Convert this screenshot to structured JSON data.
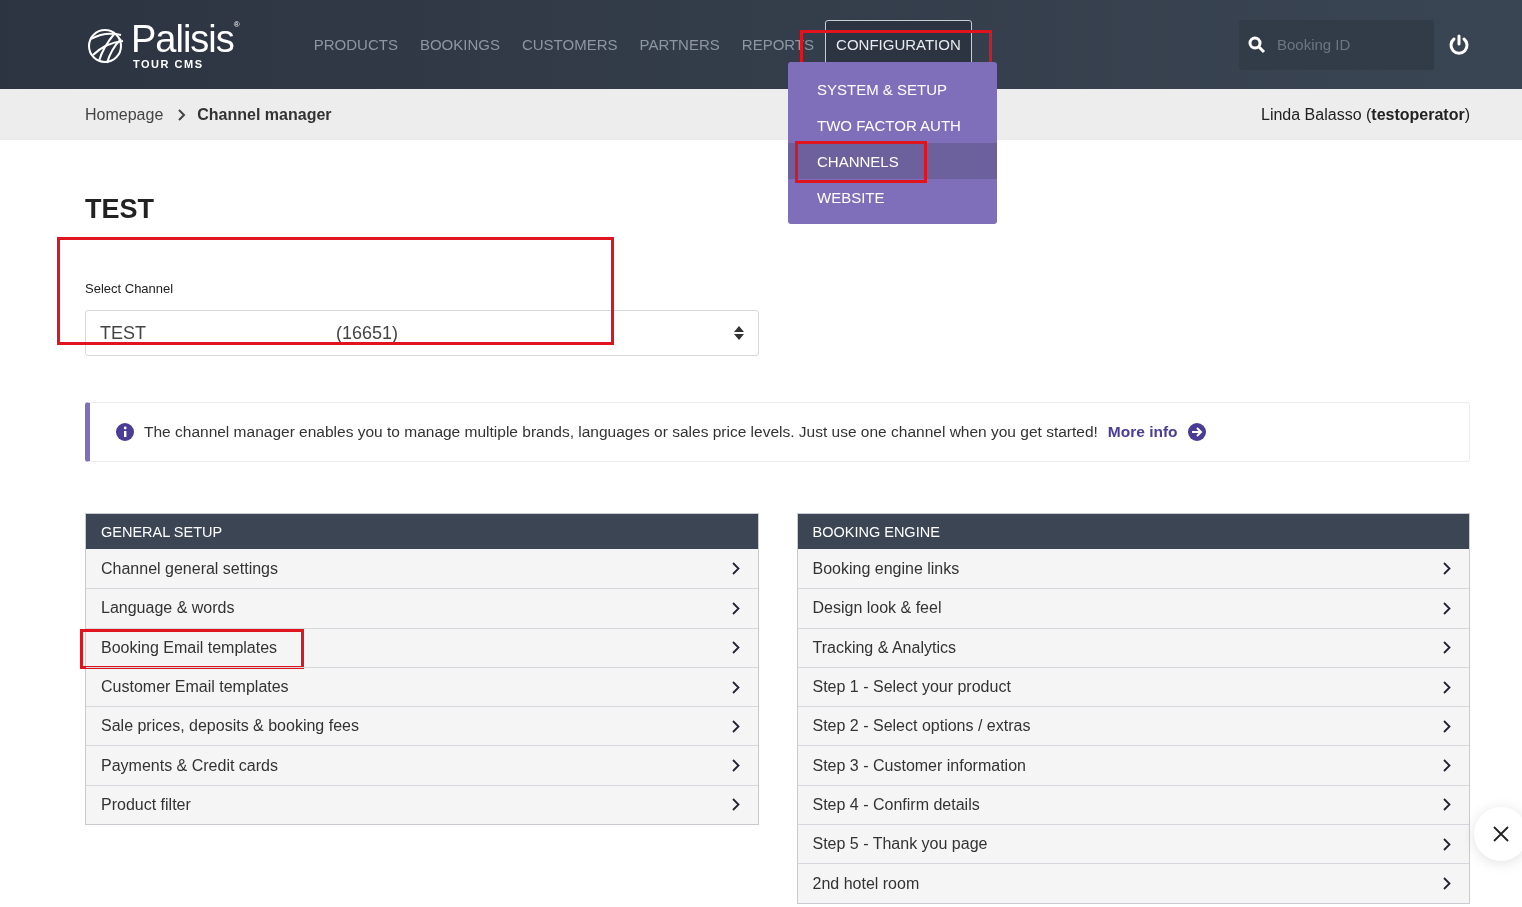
{
  "header": {
    "logo": {
      "name": "Palisis",
      "mark": "®",
      "subtitle": "TOUR CMS"
    },
    "nav": [
      {
        "label": "PRODUCTS",
        "selected": false,
        "highlighted": false
      },
      {
        "label": "BOOKINGS",
        "selected": false,
        "highlighted": false
      },
      {
        "label": "CUSTOMERS",
        "selected": false,
        "highlighted": false
      },
      {
        "label": "PARTNERS",
        "selected": false,
        "highlighted": false
      },
      {
        "label": "REPORTS",
        "selected": false,
        "highlighted": false
      },
      {
        "label": "CONFIGURATION",
        "selected": true,
        "highlighted": true
      }
    ],
    "menu": [
      {
        "label": "SYSTEM & SETUP",
        "selected": false,
        "highlighted": false
      },
      {
        "label": "TWO FACTOR AUTH",
        "selected": false,
        "highlighted": false
      },
      {
        "label": "CHANNELS",
        "selected": true,
        "highlighted": true
      },
      {
        "label": "WEBSITE",
        "selected": false,
        "highlighted": false
      }
    ],
    "search": {
      "placeholder": "Booking ID"
    }
  },
  "breadcrumb": [
    {
      "label": "Homepage"
    },
    {
      "label": "Channel manager"
    }
  ],
  "user": "Linda Balasso (**testoperator**)",
  "title": "TEST",
  "channel_select": {
    "label": "Select Channel",
    "value": "TEST",
    "code": "(16651)",
    "highlighted": true
  },
  "info": {
    "text": "The channel manager enables you to manage multiple brands, languages or sales price levels. Just use one channel when you get started!",
    "link": "More info"
  },
  "panels": [
    {
      "title": "GENERAL SETUP",
      "items": [
        {
          "label": "Channel general settings",
          "highlighted": false
        },
        {
          "label": "Language & words",
          "highlighted": false
        },
        {
          "label": "Booking Email templates",
          "highlighted": true
        },
        {
          "label": "Customer Email templates",
          "highlighted": false
        },
        {
          "label": "Sale prices, deposits & booking fees",
          "highlighted": false
        },
        {
          "label": "Payments & Credit cards",
          "highlighted": false
        },
        {
          "label": "Product filter",
          "highlighted": false
        }
      ]
    },
    {
      "title": "BOOKING ENGINE",
      "items": [
        {
          "label": "Booking engine links",
          "highlighted": false
        },
        {
          "label": "Design look & feel",
          "highlighted": false
        },
        {
          "label": "Tracking & Analytics",
          "highlighted": false
        },
        {
          "label": "Step 1 - Select your product",
          "highlighted": false
        },
        {
          "label": "Step 2 - Select options / extras",
          "highlighted": false
        },
        {
          "label": "Step 3 - Customer information",
          "highlighted": false
        },
        {
          "label": "Step 4 - Confirm details",
          "highlighted": false
        },
        {
          "label": "Step 5 - Thank you page",
          "highlighted": false
        },
        {
          "label": "2nd hotel room",
          "highlighted": false
        }
      ]
    }
  ]
}
